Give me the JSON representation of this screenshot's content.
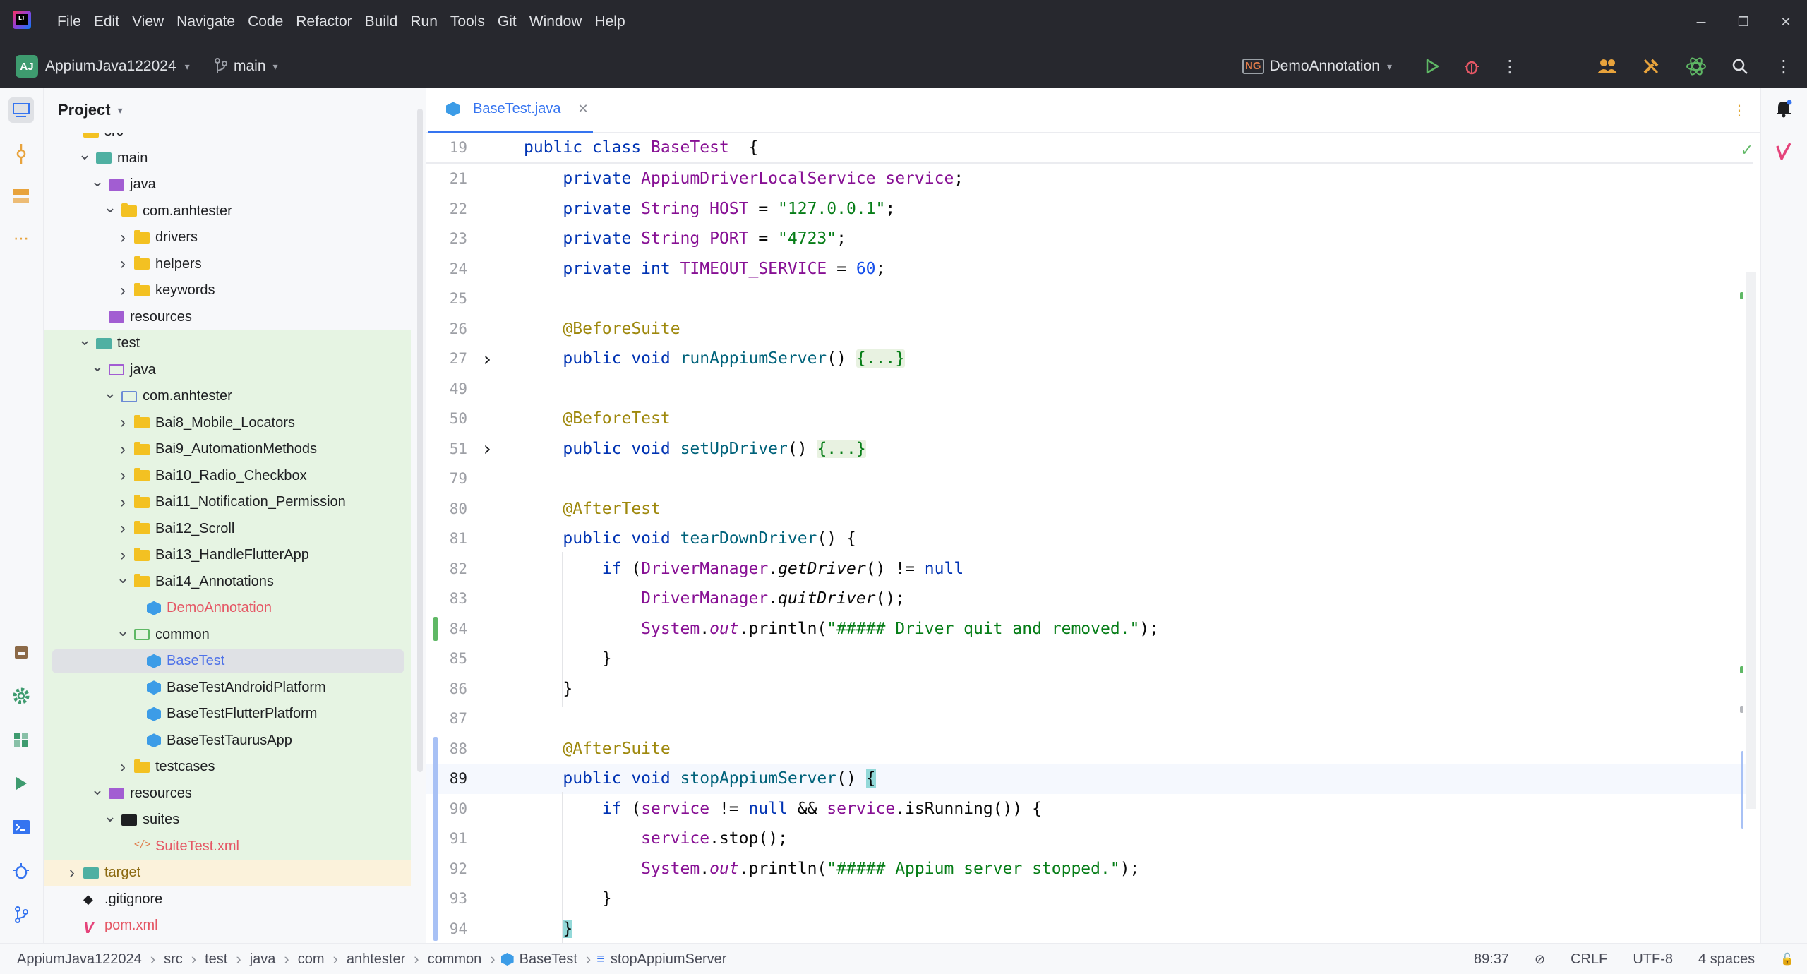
{
  "menu": [
    "File",
    "Edit",
    "View",
    "Navigate",
    "Code",
    "Refactor",
    "Build",
    "Run",
    "Tools",
    "Git",
    "Window",
    "Help"
  ],
  "toolbar": {
    "project_badge": "AJ",
    "project_name": "AppiumJava122024",
    "branch": "main",
    "run_config": "DemoAnnotation",
    "run_config_icon": "NG"
  },
  "project_panel": {
    "title": "Project",
    "tree": [
      {
        "label": "src",
        "depth": 2,
        "arrow": "",
        "icon": "folder",
        "bg": ""
      },
      {
        "label": "main",
        "depth": 3,
        "arrow": "down",
        "icon": "folder-teal",
        "bg": ""
      },
      {
        "label": "java",
        "depth": 4,
        "arrow": "down",
        "icon": "folder-purple",
        "bg": ""
      },
      {
        "label": "com.anhtester",
        "depth": 5,
        "arrow": "down",
        "icon": "folder",
        "bg": ""
      },
      {
        "label": "drivers",
        "depth": 6,
        "arrow": "right",
        "icon": "folder",
        "bg": ""
      },
      {
        "label": "helpers",
        "depth": 6,
        "arrow": "right",
        "icon": "folder",
        "bg": ""
      },
      {
        "label": "keywords",
        "depth": 6,
        "arrow": "right",
        "icon": "folder",
        "bg": ""
      },
      {
        "label": "resources",
        "depth": 4,
        "arrow": "",
        "icon": "folder-purple",
        "bg": ""
      },
      {
        "label": "test",
        "depth": 3,
        "arrow": "down",
        "icon": "folder-teal",
        "bg": "green"
      },
      {
        "label": "java",
        "depth": 4,
        "arrow": "down",
        "icon": "folder-outline-purple",
        "bg": "green"
      },
      {
        "label": "com.anhtester",
        "depth": 5,
        "arrow": "down",
        "icon": "folder-outline",
        "bg": "green"
      },
      {
        "label": "Bai8_Mobile_Locators",
        "depth": 6,
        "arrow": "right",
        "icon": "folder",
        "bg": "green"
      },
      {
        "label": "Bai9_AutomationMethods",
        "depth": 6,
        "arrow": "right",
        "icon": "folder",
        "bg": "green"
      },
      {
        "label": "Bai10_Radio_Checkbox",
        "depth": 6,
        "arrow": "right",
        "icon": "folder",
        "bg": "green"
      },
      {
        "label": "Bai11_Notification_Permission",
        "depth": 6,
        "arrow": "right",
        "icon": "folder",
        "bg": "green"
      },
      {
        "label": "Bai12_Scroll",
        "depth": 6,
        "arrow": "right",
        "icon": "folder",
        "bg": "green"
      },
      {
        "label": "Bai13_HandleFlutterApp",
        "depth": 6,
        "arrow": "right",
        "icon": "folder",
        "bg": "green"
      },
      {
        "label": "Bai14_Annotations",
        "depth": 6,
        "arrow": "down",
        "icon": "folder",
        "bg": "green"
      },
      {
        "label": "DemoAnnotation",
        "depth": 7,
        "arrow": "",
        "icon": "class",
        "bg": "green",
        "color": "red"
      },
      {
        "label": "common",
        "depth": 6,
        "arrow": "down",
        "icon": "folder-outline-green",
        "bg": "green"
      },
      {
        "label": "BaseTest",
        "depth": 7,
        "arrow": "",
        "icon": "class",
        "bg": "selected",
        "color": "blue"
      },
      {
        "label": "BaseTestAndroidPlatform",
        "depth": 7,
        "arrow": "",
        "icon": "class",
        "bg": "green"
      },
      {
        "label": "BaseTestFlutterPlatform",
        "depth": 7,
        "arrow": "",
        "icon": "class",
        "bg": "green"
      },
      {
        "label": "BaseTestTaurusApp",
        "depth": 7,
        "arrow": "",
        "icon": "class",
        "bg": "green"
      },
      {
        "label": "testcases",
        "depth": 6,
        "arrow": "right",
        "icon": "folder",
        "bg": "green"
      },
      {
        "label": "resources",
        "depth": 4,
        "arrow": "down",
        "icon": "folder-purple",
        "bg": "green"
      },
      {
        "label": "suites",
        "depth": 5,
        "arrow": "down",
        "icon": "folder-black",
        "bg": "green"
      },
      {
        "label": "SuiteTest.xml",
        "depth": 6,
        "arrow": "",
        "icon": "xml",
        "bg": "green",
        "color": "red"
      },
      {
        "label": "target",
        "depth": 2,
        "arrow": "right",
        "icon": "folder-teal",
        "bg": "yellow",
        "color": "brown"
      },
      {
        "label": ".gitignore",
        "depth": 2,
        "arrow": "",
        "icon": "git",
        "bg": ""
      },
      {
        "label": "pom.xml",
        "depth": 2,
        "arrow": "",
        "icon": "maven",
        "bg": "",
        "color": "red"
      }
    ]
  },
  "editor": {
    "tab_label": "BaseTest.java",
    "sticky_line": {
      "num": "19",
      "parts": [
        [
          "kw",
          "public class "
        ],
        [
          "cls",
          "BaseTest"
        ],
        [
          "",
          "  {"
        ]
      ]
    },
    "lines": [
      {
        "num": "21",
        "parts": [
          [
            "kw",
            "    private "
          ],
          [
            "ty",
            "AppiumDriverLocalService "
          ],
          [
            "fld",
            "service"
          ],
          [
            "",
            ";"
          ]
        ]
      },
      {
        "num": "22",
        "parts": [
          [
            "kw",
            "    private "
          ],
          [
            "ty",
            "String "
          ],
          [
            "fld",
            "HOST"
          ],
          [
            "",
            " = "
          ],
          [
            "str",
            "\"127.0.0.1\""
          ],
          [
            "",
            ";"
          ]
        ]
      },
      {
        "num": "23",
        "parts": [
          [
            "kw",
            "    private "
          ],
          [
            "ty",
            "String "
          ],
          [
            "fld",
            "PORT"
          ],
          [
            "",
            " = "
          ],
          [
            "str",
            "\"4723\""
          ],
          [
            "",
            ";"
          ]
        ]
      },
      {
        "num": "24",
        "parts": [
          [
            "kw",
            "    private int "
          ],
          [
            "fld",
            "TIMEOUT_SERVICE"
          ],
          [
            "",
            " = "
          ],
          [
            "num",
            "60"
          ],
          [
            "",
            ";"
          ]
        ]
      },
      {
        "num": "25",
        "parts": []
      },
      {
        "num": "26",
        "parts": [
          [
            "ann",
            "    @BeforeSuite"
          ]
        ]
      },
      {
        "num": "27",
        "fold": true,
        "parts": [
          [
            "kw",
            "    public void "
          ],
          [
            "mth",
            "runAppiumServer"
          ],
          [
            "",
            "() "
          ],
          [
            "fold",
            "{...}"
          ]
        ]
      },
      {
        "num": "49",
        "parts": []
      },
      {
        "num": "50",
        "parts": [
          [
            "ann",
            "    @BeforeTest"
          ]
        ]
      },
      {
        "num": "51",
        "fold": true,
        "parts": [
          [
            "kw",
            "    public void "
          ],
          [
            "mth",
            "setUpDriver"
          ],
          [
            "",
            "() "
          ],
          [
            "fold",
            "{...}"
          ]
        ]
      },
      {
        "num": "79",
        "parts": []
      },
      {
        "num": "80",
        "parts": [
          [
            "ann",
            "    @AfterTest"
          ]
        ]
      },
      {
        "num": "81",
        "parts": [
          [
            "kw",
            "    public void "
          ],
          [
            "mth",
            "tearDownDriver"
          ],
          [
            "",
            "() {"
          ]
        ]
      },
      {
        "num": "82",
        "parts": [
          [
            "kw",
            "        if "
          ],
          [
            "",
            "("
          ],
          [
            "ty",
            "DriverManager"
          ],
          [
            "",
            "."
          ],
          [
            "ital",
            "getDriver"
          ],
          [
            "",
            "() != "
          ],
          [
            "kw",
            "null"
          ],
          [
            ") {",
            ""
          ]
        ]
      },
      {
        "num": "83",
        "parts": [
          [
            "ty",
            "            DriverManager"
          ],
          [
            "",
            "."
          ],
          [
            "ital",
            "quitDriver"
          ],
          [
            "",
            "();"
          ]
        ]
      },
      {
        "num": "84",
        "parts": [
          [
            "ty",
            "            System"
          ],
          [
            "",
            "."
          ],
          [
            "fldi",
            "out"
          ],
          [
            "",
            ".println("
          ],
          [
            "str",
            "\"##### Driver quit and removed.\""
          ],
          [
            "",
            ");"
          ]
        ]
      },
      {
        "num": "85",
        "parts": [
          [
            "",
            "        }"
          ]
        ]
      },
      {
        "num": "86",
        "parts": [
          [
            "",
            "    }"
          ]
        ]
      },
      {
        "num": "87",
        "parts": []
      },
      {
        "num": "88",
        "parts": [
          [
            "ann",
            "    @AfterSuite"
          ]
        ]
      },
      {
        "num": "89",
        "current": true,
        "parts": [
          [
            "kw",
            "    public void "
          ],
          [
            "mth",
            "stopAppiumServer"
          ],
          [
            "",
            "() "
          ],
          [
            "brace",
            "{"
          ]
        ]
      },
      {
        "num": "90",
        "parts": [
          [
            "kw",
            "        if "
          ],
          [
            "",
            "("
          ],
          [
            "fld",
            "service"
          ],
          [
            "",
            " != "
          ],
          [
            "kw",
            "null"
          ],
          [
            "",
            " && "
          ],
          [
            "fld",
            "service"
          ],
          [
            "",
            ".isRunning()) {"
          ]
        ]
      },
      {
        "num": "91",
        "parts": [
          [
            "fld",
            "            service"
          ],
          [
            "",
            ".stop();"
          ]
        ]
      },
      {
        "num": "92",
        "parts": [
          [
            "ty",
            "            System"
          ],
          [
            "",
            "."
          ],
          [
            "fldi",
            "out"
          ],
          [
            "",
            ".println("
          ],
          [
            "str",
            "\"##### Appium server stopped.\""
          ],
          [
            "",
            ");"
          ]
        ]
      },
      {
        "num": "93",
        "parts": [
          [
            "",
            "        }"
          ]
        ]
      },
      {
        "num": "94",
        "parts": [
          [
            "brace",
            "    }"
          ]
        ]
      }
    ]
  },
  "statusbar": {
    "breadcrumbs": [
      "AppiumJava122024",
      "src",
      "test",
      "java",
      "com",
      "anhtester",
      "common",
      "BaseTest",
      "stopAppiumServer"
    ],
    "position": "89:37",
    "line_sep": "CRLF",
    "encoding": "UTF-8",
    "indent": "4 spaces"
  },
  "colors": {
    "accent": "#3574f0",
    "titlebar": "#27282e",
    "keyword": "#0033b3",
    "string": "#067d17",
    "annotation": "#9e880d",
    "method": "#00627a",
    "field": "#871094"
  }
}
